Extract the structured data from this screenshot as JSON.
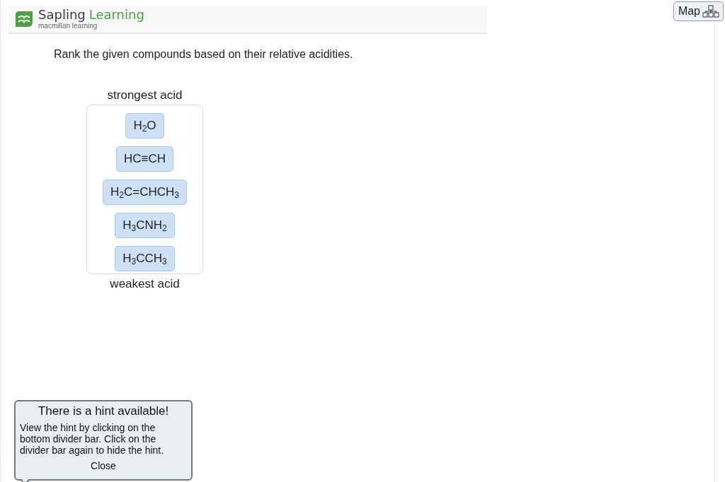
{
  "header": {
    "brand_first": "Sapling",
    "brand_second": "Learning",
    "tagline": "macmillan learning"
  },
  "map_button": {
    "label": "Map"
  },
  "question": "Rank the given compounds based on their relative acidities.",
  "ranking": {
    "top_label": "strongest acid",
    "bottom_label": "weakest acid",
    "items": [
      {
        "formula": "H$_{2}$O"
      },
      {
        "formula": "HC≡CH"
      },
      {
        "formula": "H$_{2}$C=CHCH$_{3}$"
      },
      {
        "formula": "H$_{3}$CNH$_{2}$"
      },
      {
        "formula": "H$_{3}$CCH$_{3}$"
      }
    ]
  },
  "hint_popup": {
    "title": "There is a hint available!",
    "body": "View the hint by clicking on the bottom divider bar. Click on the divider bar again to hide the hint.",
    "close": "Close"
  }
}
